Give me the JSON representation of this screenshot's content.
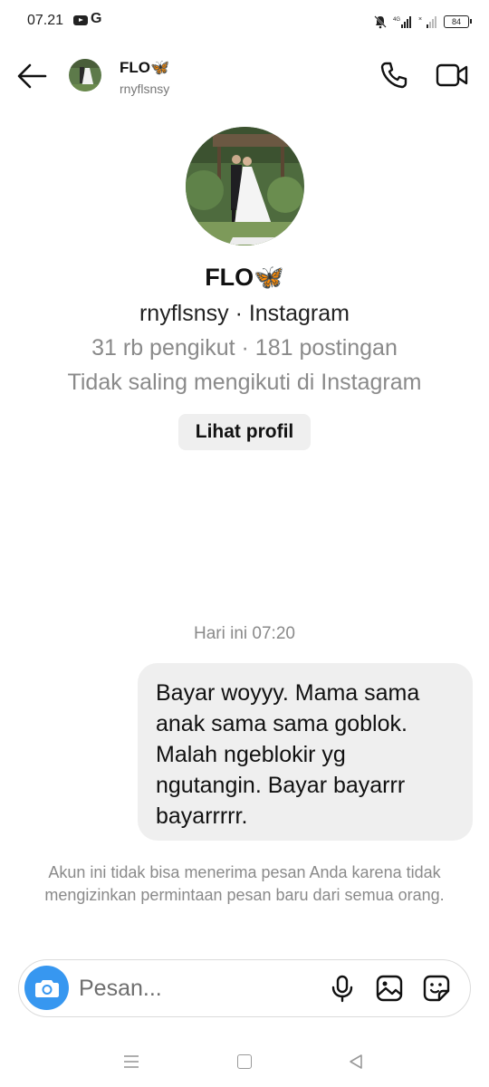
{
  "status_bar": {
    "time": "07.21",
    "icons": [
      "youtube-icon",
      "g-icon",
      "bell-off-icon",
      "signal-4g-icon",
      "signal-icon",
      "battery-icon"
    ],
    "battery": "84"
  },
  "header": {
    "name": "FLO🦋",
    "username": "rnyflsnsy"
  },
  "profile": {
    "name": "FLO🦋",
    "subtitle": "rnyflsnsy · Instagram",
    "stats": "31 rb pengikut · 181 postingan",
    "follow_status": "Tidak saling mengikuti di Instagram",
    "view_profile_label": "Lihat profil"
  },
  "chat": {
    "date_separator": "Hari ini 07:20",
    "messages": [
      {
        "text": "Bayar woyyy.  Mama sama anak sama sama goblok. Malah ngeblokir yg ngutangin. Bayar bayarrr bayarrrrr."
      }
    ],
    "notice": "Akun ini tidak bisa menerima pesan Anda karena tidak mengizinkan permintaan pesan baru dari semua orang."
  },
  "composer": {
    "placeholder": "Pesan..."
  },
  "colors": {
    "accent": "#3797f0",
    "bubble": "#efefef",
    "muted_text": "#8a8a8a"
  }
}
